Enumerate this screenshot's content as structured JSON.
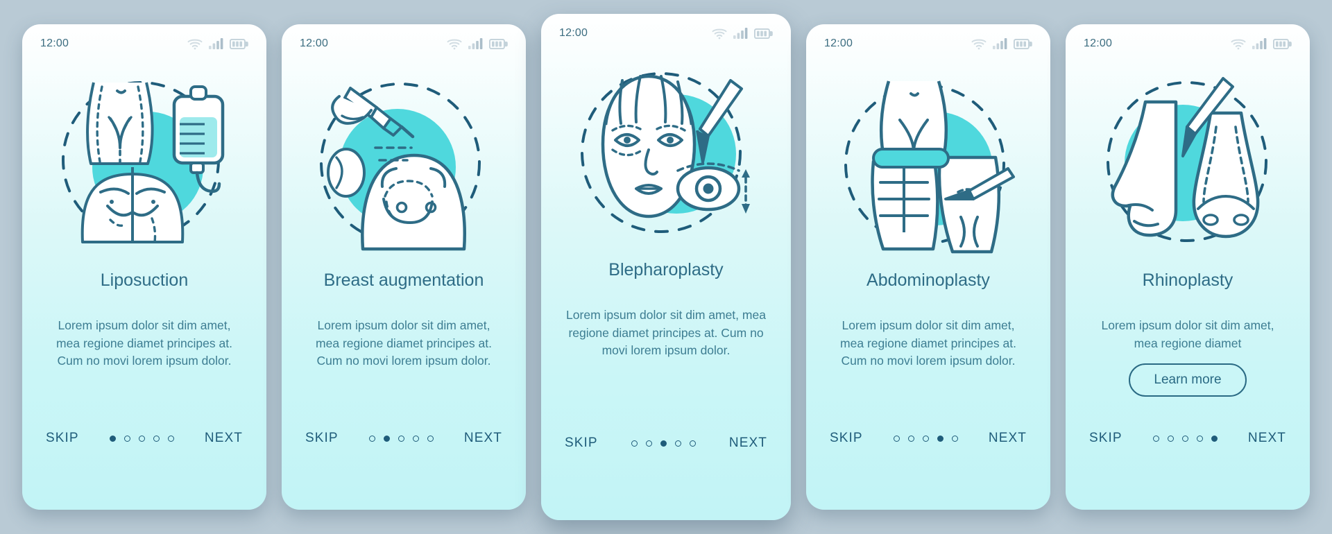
{
  "page": {
    "background_color": "#b9cad5",
    "accent_color": "#4fd8dd",
    "ink_color": "#2e6c86",
    "deep_ink_color": "#1f5c7a"
  },
  "status_bar": {
    "time": "12:00",
    "icons": [
      "wifi-icon",
      "cellular-signal-icon",
      "battery-icon"
    ]
  },
  "nav": {
    "skip_label": "SKIP",
    "next_label": "NEXT",
    "dot_count": 5
  },
  "screens": [
    {
      "id": "liposuction",
      "illustration": "liposuction-illustration",
      "title": "Liposuction",
      "body": "Lorem ipsum dolor sit dim amet, mea regione diamet principes at. Cum no movi lorem ipsum dolor.",
      "active_dot": 1,
      "cta_label": null,
      "featured": false
    },
    {
      "id": "breast-augmentation",
      "illustration": "breast-augmentation-illustration",
      "title": "Breast augmentation",
      "body": "Lorem ipsum dolor sit dim amet, mea regione diamet principes at. Cum no movi lorem ipsum dolor.",
      "active_dot": 2,
      "cta_label": null,
      "featured": false
    },
    {
      "id": "blepharoplasty",
      "illustration": "blepharoplasty-illustration",
      "title": "Blepharoplasty",
      "body": "Lorem ipsum dolor sit dim amet, mea regione diamet principes at. Cum no movi lorem ipsum dolor.",
      "active_dot": 3,
      "cta_label": null,
      "featured": true
    },
    {
      "id": "abdominoplasty",
      "illustration": "abdominoplasty-illustration",
      "title": "Abdominoplasty",
      "body": "Lorem ipsum dolor sit dim amet, mea regione diamet principes at. Cum no movi lorem ipsum dolor.",
      "active_dot": 4,
      "cta_label": null,
      "featured": false
    },
    {
      "id": "rhinoplasty",
      "illustration": "rhinoplasty-illustration",
      "title": "Rhinoplasty",
      "body": "Lorem ipsum dolor sit dim amet, mea regione diamet",
      "active_dot": 5,
      "cta_label": "Learn more",
      "featured": false
    }
  ]
}
